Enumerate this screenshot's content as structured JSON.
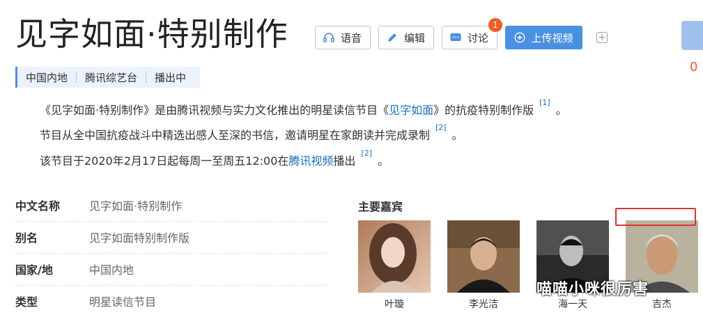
{
  "header": {
    "title": "见字如面·特别制作",
    "btn_voice": "语音",
    "btn_edit": "编辑",
    "btn_discuss": "讨论",
    "discuss_badge": "1",
    "btn_upload": "上传视频",
    "like_count": "0"
  },
  "tags": [
    "中国内地",
    "腾讯综艺台",
    "播出中"
  ],
  "summary": {
    "p1_a": "《见字如面·特别制作》是由腾讯视频与实力文化推出的明星读信节目《",
    "p1_link": "见字如面",
    "p1_b": "》的抗疫特别制作版",
    "p1_ref": "[1]",
    "p1_end": "。",
    "p2_text": "节目从全中国抗疫战斗中精选出感人至深的书信，邀请明星在家朗读并完成录制",
    "p2_ref": "[2]",
    "p2_end": "。",
    "p3_a": "该节目于2020年2月17日起每周一至周五12:00在",
    "p3_link": "腾讯视频",
    "p3_b": "播出",
    "p3_ref": "[2]",
    "p3_end": "。"
  },
  "info": [
    {
      "key": "中文名称",
      "value": "见字如面·特别制作"
    },
    {
      "key": "别名",
      "value": "见字如面特别制作版"
    },
    {
      "key": "国家/地",
      "value": "中国内地"
    },
    {
      "key": "类型",
      "value": "明星读信节目"
    }
  ],
  "guests": {
    "title": "主要嘉宾",
    "items": [
      {
        "name": "叶璇"
      },
      {
        "name": "李光洁"
      },
      {
        "name": "海一天"
      },
      {
        "name": "吉杰"
      }
    ]
  },
  "watermark": "喵喵小咪很厉害",
  "colors": {
    "link": "#136ec2",
    "accent": "#4a90e2",
    "badge": "#f55b23",
    "highlight_box": "#e53030"
  }
}
